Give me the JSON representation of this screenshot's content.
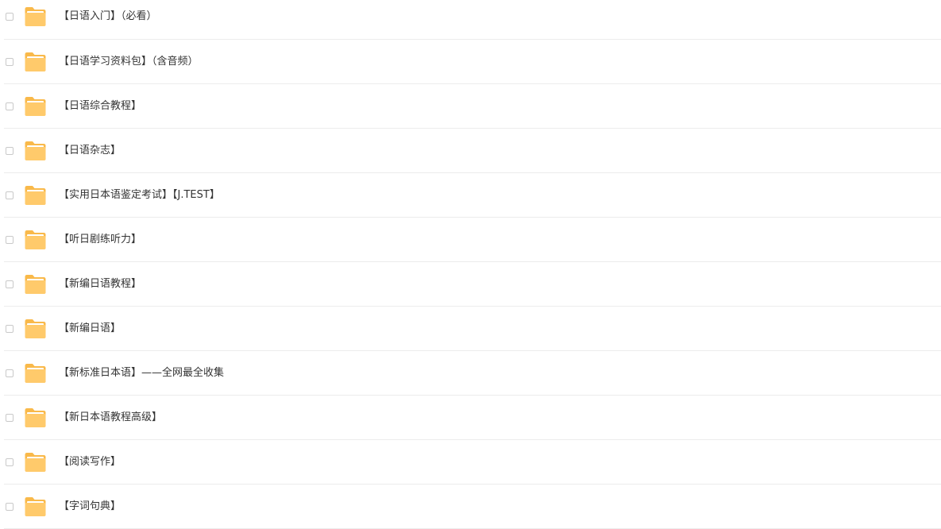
{
  "files": [
    {
      "name": "【日语入门】（必看）",
      "icon": "folder-icon"
    },
    {
      "name": "【日语学习资料包】（含音频）",
      "icon": "folder-icon"
    },
    {
      "name": "【日语综合教程】",
      "icon": "folder-icon"
    },
    {
      "name": "【日语杂志】",
      "icon": "folder-icon"
    },
    {
      "name": "【实用日本语鉴定考试】【J.TEST】",
      "icon": "folder-icon"
    },
    {
      "name": "【听日剧练听力】",
      "icon": "folder-icon"
    },
    {
      "name": "【新编日语教程】",
      "icon": "folder-icon"
    },
    {
      "name": "【新编日语】",
      "icon": "folder-icon"
    },
    {
      "name": "【新标准日本语】——全网最全收集",
      "icon": "folder-icon"
    },
    {
      "name": "【新日本语教程高级】",
      "icon": "folder-icon"
    },
    {
      "name": "【阅读写作】",
      "icon": "folder-icon"
    },
    {
      "name": "【字词句典】",
      "icon": "folder-icon"
    }
  ],
  "colors": {
    "folder_body": "#FFCA6B",
    "folder_back": "#F9B94A",
    "folder_paper": "#FFFFFF",
    "text": "#333333",
    "divider": "#ECECEC",
    "checkbox_border": "#C9C9C9"
  }
}
